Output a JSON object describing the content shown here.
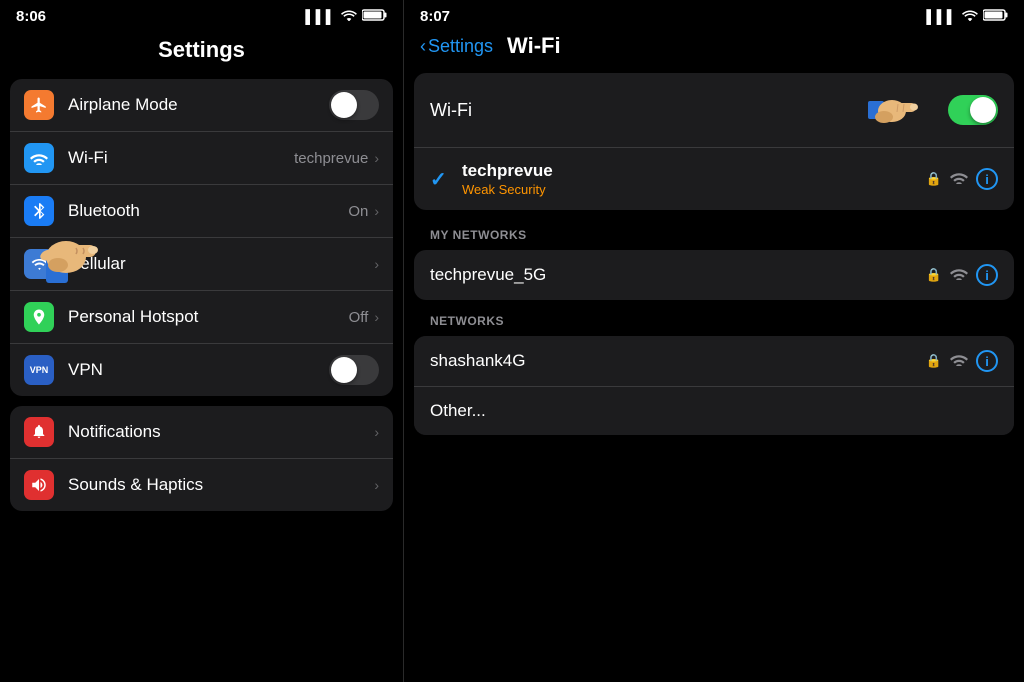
{
  "left": {
    "status_time": "8:06",
    "status_signal": "▌▌▌",
    "status_wifi": "wifi",
    "status_battery": "🔋",
    "page_title": "Settings",
    "items": [
      {
        "id": "airplane",
        "icon_bg": "icon-orange",
        "icon_char": "✈",
        "label": "Airplane Mode",
        "value": "",
        "has_toggle": true,
        "toggle_on": false,
        "has_chevron": false
      },
      {
        "id": "wifi",
        "icon_bg": "icon-blue",
        "icon_char": "wifi",
        "label": "Wi-Fi",
        "value": "techprevue",
        "has_toggle": false,
        "toggle_on": false,
        "has_chevron": true
      },
      {
        "id": "bluetooth",
        "icon_bg": "icon-blue2",
        "icon_char": "bt",
        "label": "Bluetooth",
        "value": "On",
        "has_toggle": false,
        "toggle_on": false,
        "has_chevron": true
      },
      {
        "id": "cellular",
        "icon_bg": "icon-blue3",
        "icon_char": "cell",
        "label": "Cellular",
        "value": "",
        "has_toggle": false,
        "toggle_on": false,
        "has_chevron": true
      },
      {
        "id": "hotspot",
        "icon_bg": "icon-green",
        "icon_char": "⊕",
        "label": "Personal Hotspot",
        "value": "Off",
        "has_toggle": false,
        "toggle_on": false,
        "has_chevron": true
      },
      {
        "id": "vpn",
        "icon_bg": "icon-blue-vpn",
        "icon_char": "VPN",
        "label": "VPN",
        "value": "",
        "has_toggle": true,
        "toggle_on": false,
        "has_chevron": false
      }
    ],
    "bottom_items": [
      {
        "id": "notifications",
        "icon_bg": "icon-red",
        "icon_char": "🔔",
        "label": "Notifications",
        "has_chevron": true
      },
      {
        "id": "sounds",
        "icon_bg": "icon-red2",
        "icon_char": "🔊",
        "label": "Sounds & Haptics",
        "has_chevron": true
      }
    ]
  },
  "right": {
    "status_time": "8:07",
    "back_label": "Settings",
    "page_title": "Wi-Fi",
    "wifi_label": "Wi-Fi",
    "wifi_toggle_on": true,
    "connected_network": {
      "name": "techprevue",
      "subtitle": "Weak Security"
    },
    "my_networks_header": "MY NETWORKS",
    "my_networks": [
      {
        "name": "techprevue_5G"
      }
    ],
    "networks_header": "NETWORKS",
    "networks": [
      {
        "name": "shashank4G"
      },
      {
        "name": "Other..."
      }
    ]
  }
}
